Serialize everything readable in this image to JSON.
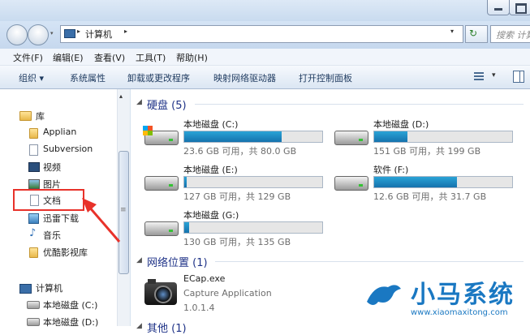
{
  "address": {
    "path": "计算机"
  },
  "search": {
    "placeholder": "搜索 计算"
  },
  "menu": [
    "文件(F)",
    "编辑(E)",
    "查看(V)",
    "工具(T)",
    "帮助(H)"
  ],
  "toolbar": [
    "组织 ▾",
    "系统属性",
    "卸载或更改程序",
    "映射网络驱动器",
    "打开控制面板"
  ],
  "nav": {
    "library": "库",
    "items": [
      "Applian",
      "Subversion",
      "视频",
      "图片",
      "文档",
      "迅雷下载",
      "音乐",
      "优酷影视库"
    ],
    "computer": "计算机",
    "drives": [
      "本地磁盘 (C:)",
      "本地磁盘 (D:)"
    ]
  },
  "groups": {
    "hdd": "硬盘 (5)",
    "net": "网络位置 (1)",
    "other": "其他 (1)"
  },
  "drives": [
    {
      "name": "本地磁盘 (C:)",
      "info": "23.6 GB 可用，共 80.0 GB",
      "used": 0.705
    },
    {
      "name": "本地磁盘 (D:)",
      "info": "151 GB 可用，共 199 GB",
      "used": 0.24
    },
    {
      "name": "本地磁盘 (E:)",
      "info": "127 GB 可用，共 129 GB",
      "used": 0.016
    },
    {
      "name": "软件 (F:)",
      "info": "12.6 GB 可用，共 31.7 GB",
      "used": 0.6
    },
    {
      "name": "本地磁盘 (G:)",
      "info": "130 GB 可用，共 135 GB",
      "used": 0.037
    }
  ],
  "network": {
    "name": "ECap.exe",
    "desc": "Capture Application",
    "version": "1.0.1.4"
  },
  "watermark": {
    "title": "小马系统",
    "url": "www.xiaomaxitong.com"
  },
  "colors": {
    "accent": "#1572ad",
    "highlight": "#e8322a",
    "group": "#1e3287"
  }
}
